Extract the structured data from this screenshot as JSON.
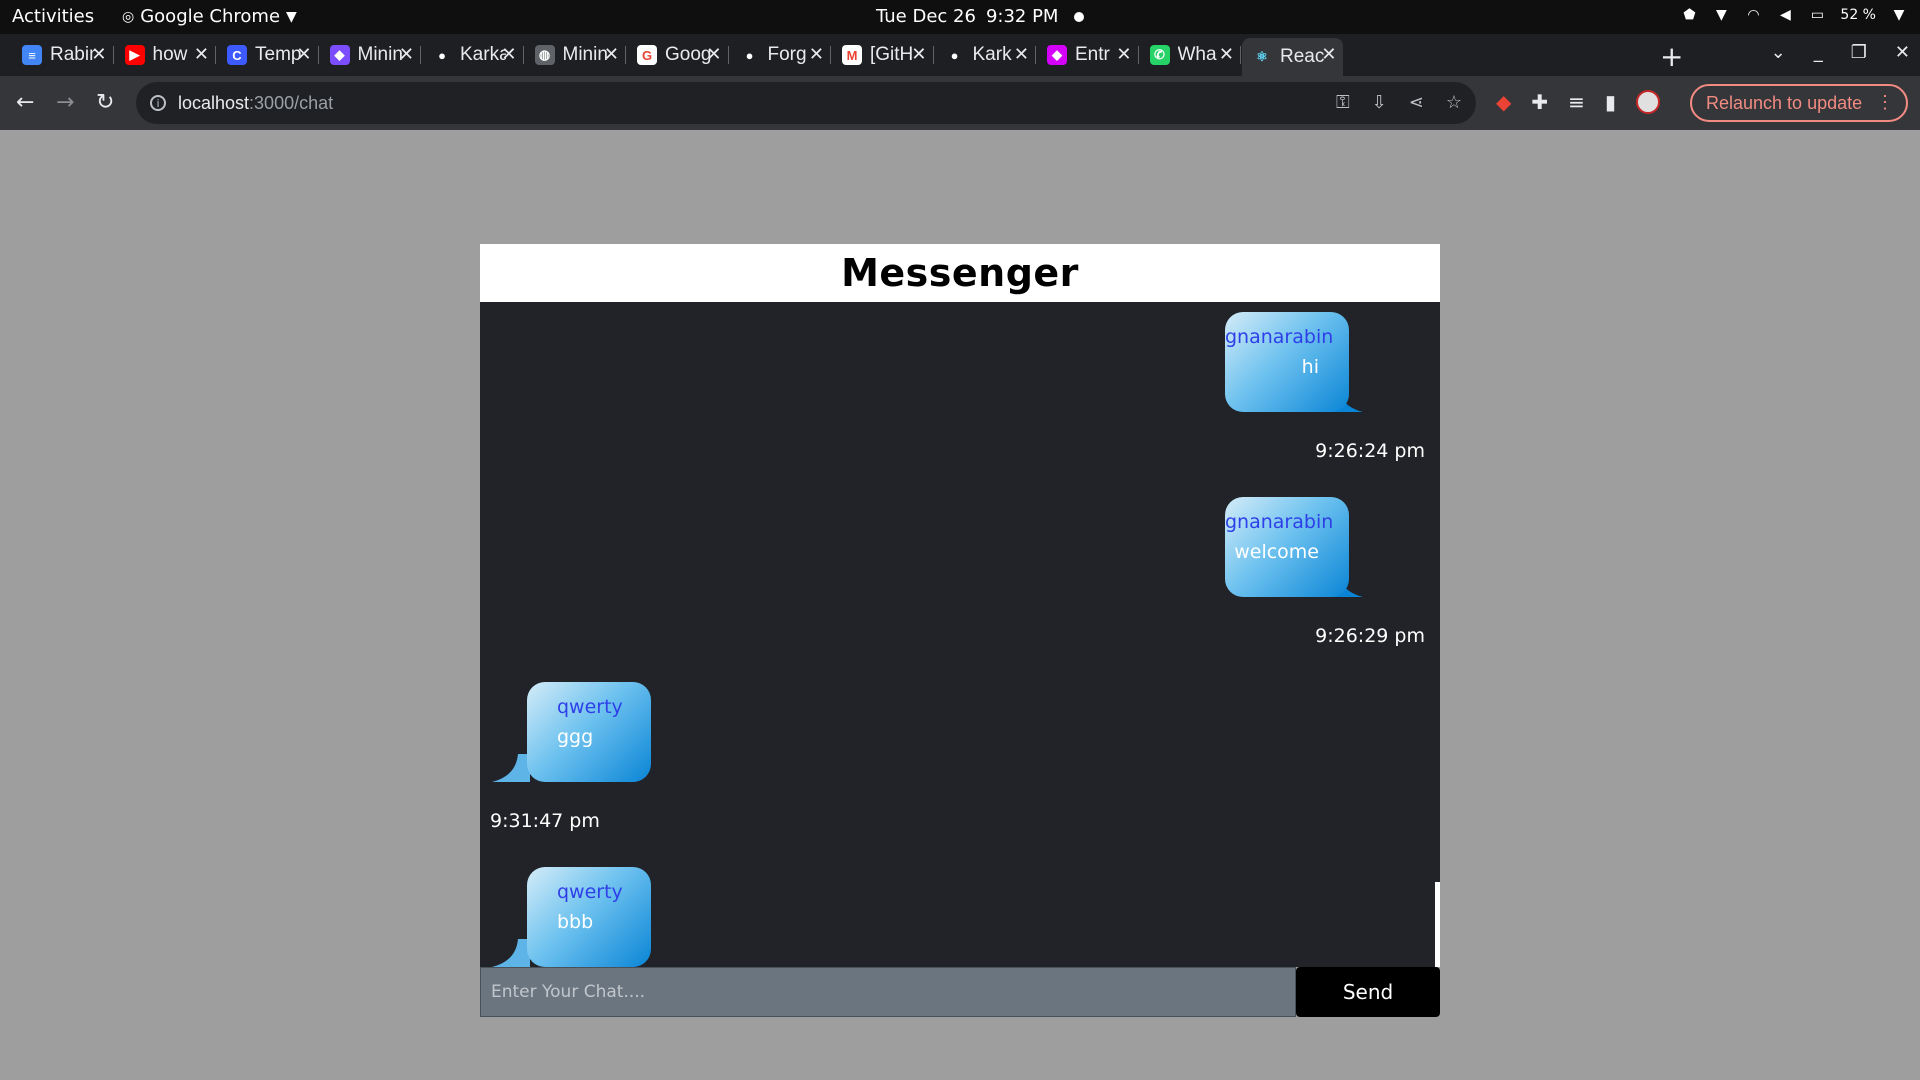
{
  "system_bar": {
    "activities": "Activities",
    "app_name": "Google Chrome",
    "date": "Tue Dec 26",
    "time": "9:32 PM",
    "battery": "52 %"
  },
  "tabs": [
    {
      "title": "Rabin",
      "favicon_color": "#4285f4",
      "favicon_glyph": "≡",
      "icon": "docs-icon"
    },
    {
      "title": "how",
      "favicon_color": "#ff0000",
      "favicon_glyph": "▶",
      "icon": "youtube-icon"
    },
    {
      "title": "Temp",
      "favicon_color": "#3d5afe",
      "favicon_glyph": "C",
      "icon": "canva-icon"
    },
    {
      "title": "Minin",
      "favicon_color": "#7c4dff",
      "favicon_glyph": "◆",
      "icon": "app-icon"
    },
    {
      "title": "Karka",
      "favicon_color": "#1e1f22",
      "favicon_glyph": "●",
      "icon": "github-icon"
    },
    {
      "title": "Minin",
      "favicon_color": "#5f6368",
      "favicon_glyph": "◍",
      "icon": "globe-icon"
    },
    {
      "title": "Goog",
      "favicon_color": "#ffffff",
      "favicon_glyph": "G",
      "icon": "google-icon"
    },
    {
      "title": "Forg",
      "favicon_color": "#1e1f22",
      "favicon_glyph": "●",
      "icon": "github-icon"
    },
    {
      "title": "[GitH",
      "favicon_color": "#ffffff",
      "favicon_glyph": "M",
      "icon": "gmail-icon"
    },
    {
      "title": "Kark",
      "favicon_color": "#1e1f22",
      "favicon_glyph": "●",
      "icon": "github-icon"
    },
    {
      "title": "Entr",
      "favicon_color": "#d500f9",
      "favicon_glyph": "◆",
      "icon": "app-icon"
    },
    {
      "title": "Wha",
      "favicon_color": "#25d366",
      "favicon_glyph": "✆",
      "icon": "whatsapp-icon"
    },
    {
      "title": "Reac",
      "favicon_color": "#35363a",
      "favicon_glyph": "⚛",
      "icon": "react-icon",
      "active": true
    }
  ],
  "address_bar": {
    "host": "localhost",
    "path": ":3000/chat"
  },
  "relaunch_label": "Relaunch to update",
  "page": {
    "title": "Messenger",
    "messages": [
      {
        "side": "right",
        "user": "gnanarabin",
        "text": "hi",
        "time": "9:26:24 pm"
      },
      {
        "side": "right",
        "user": "gnanarabin",
        "text": "welcome",
        "time": "9:26:29 pm"
      },
      {
        "side": "left",
        "user": "qwerty",
        "text": "ggg",
        "time": "9:31:47 pm"
      },
      {
        "side": "left",
        "user": "qwerty",
        "text": "bbb",
        "time": ""
      }
    ],
    "input_placeholder": "Enter Your Chat....",
    "send_label": "Send"
  },
  "colors": {
    "page_bg": "#9e9e9e",
    "chat_bg": "#212329",
    "username": "#2f3fe8",
    "bubble_dark": "#0a85d6",
    "bubble_light": "#d4ecf8",
    "input_bg": "#6b7580",
    "send_bg": "#000000"
  }
}
